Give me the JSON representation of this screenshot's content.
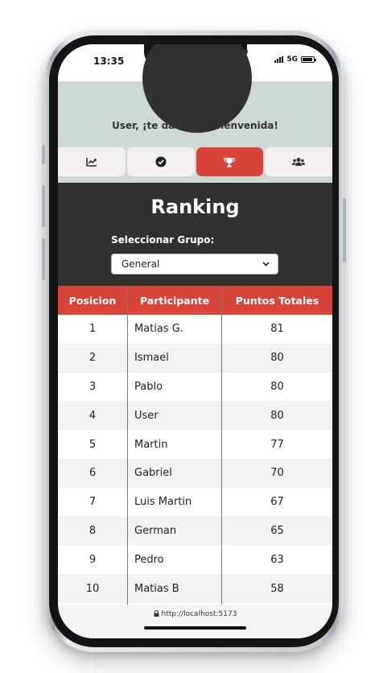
{
  "status_bar": {
    "time": "13:35",
    "network": "5G"
  },
  "header": {
    "welcome_text": "User, ¡te damos la bienvenida!"
  },
  "tabs": [
    {
      "icon": "chart-icon",
      "active": false
    },
    {
      "icon": "check-circle-icon",
      "active": false
    },
    {
      "icon": "trophy-icon",
      "active": true
    },
    {
      "icon": "users-icon",
      "active": false
    }
  ],
  "ranking": {
    "title": "Ranking",
    "group_label": "Seleccionar Grupo:",
    "selected_group": "General"
  },
  "table": {
    "headers": [
      "Posicion",
      "Participante",
      "Puntos Totales"
    ],
    "rows": [
      [
        "1",
        "Matias G.",
        "81"
      ],
      [
        "2",
        "Ismael",
        "80"
      ],
      [
        "3",
        "Pablo",
        "80"
      ],
      [
        "4",
        "User",
        "80"
      ],
      [
        "5",
        "Martin",
        "77"
      ],
      [
        "6",
        "Gabriel",
        "70"
      ],
      [
        "7",
        "Luis Martin",
        "67"
      ],
      [
        "8",
        "German",
        "65"
      ],
      [
        "9",
        "Pedro",
        "63"
      ],
      [
        "10",
        "Matias B",
        "58"
      ]
    ]
  },
  "browser": {
    "url": "http://localhost:5173"
  },
  "colors": {
    "accent": "#d9443a",
    "header_bg": "#cdd9d5",
    "panel_bg": "#333030"
  }
}
